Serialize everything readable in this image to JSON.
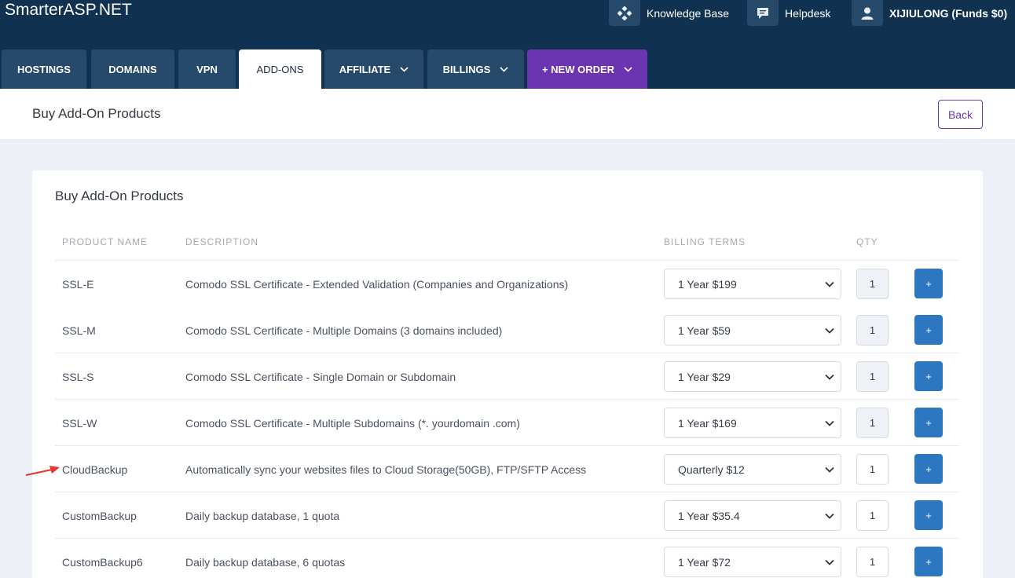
{
  "header": {
    "brand": "SmarterASP.NET",
    "knowledge_base": "Knowledge Base",
    "helpdesk": "Helpdesk",
    "user": "XIJIULONG (Funds $0)"
  },
  "tabs": [
    {
      "label": "HOSTINGS"
    },
    {
      "label": "DOMAINS"
    },
    {
      "label": "VPN"
    },
    {
      "label": "ADD-ONS",
      "active": true
    },
    {
      "label": "AFFILIATE"
    },
    {
      "label": "BILLINGS"
    },
    {
      "label": "+ NEW ORDER"
    }
  ],
  "page": {
    "title": "Buy Add-On Products",
    "back_label": "Back"
  },
  "card": {
    "title": "Buy Add-On Products",
    "columns": [
      "PRODUCT NAME",
      "DESCRIPTION",
      "BILLING TERMS",
      "QTY"
    ]
  },
  "products": [
    {
      "name": "SSL-E",
      "description": "Comodo SSL Certificate - Extended Validation (Companies and Organizations)",
      "term": "1 Year  $199",
      "qty": "1",
      "add": "+"
    },
    {
      "name": "SSL-M",
      "description": "Comodo SSL Certificate - Multiple Domains (3 domains included)",
      "term": "1 Year  $59",
      "qty": "1",
      "add": "+"
    },
    {
      "name": "SSL-S",
      "description": "Comodo SSL Certificate - Single Domain or Subdomain",
      "term": "1 Year  $29",
      "qty": "1",
      "add": "+"
    },
    {
      "name": "SSL-W",
      "description": "Comodo SSL Certificate - Multiple Subdomains (*. yourdomain .com)",
      "term": "1 Year  $169",
      "qty": "1",
      "add": "+"
    },
    {
      "name": "CloudBackup",
      "description": "Automatically sync your websites files to Cloud Storage(50GB), FTP/SFTP Access",
      "term": "Quarterly  $12",
      "qty": "1",
      "add": "+"
    },
    {
      "name": "CustomBackup",
      "description": "Daily backup database, 1 quota",
      "term": "1 Year  $35.4",
      "qty": "1",
      "add": "+"
    },
    {
      "name": "CustomBackup6",
      "description": "Daily backup database, 6 quotas",
      "term": "1 Year  $72",
      "qty": "1",
      "add": "+"
    }
  ],
  "colors": {
    "header_bg": "#10314f",
    "tab_bg": "#274a6b",
    "new_order_bg": "#6b34b0",
    "add_button": "#2d77c1",
    "annotation_arrow": "#e8342b"
  }
}
